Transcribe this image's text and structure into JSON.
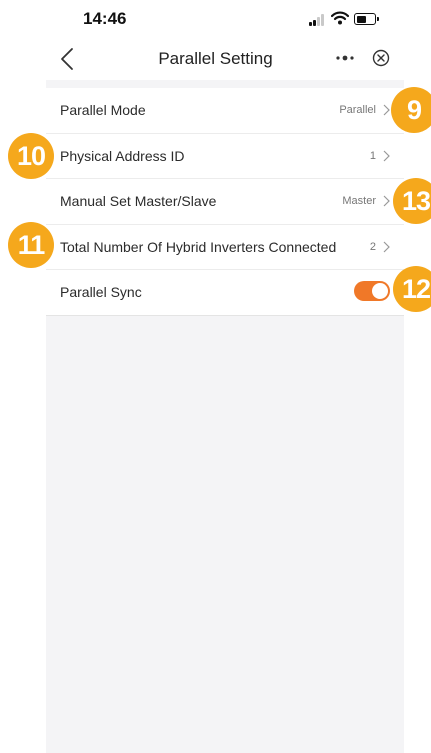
{
  "status_bar": {
    "time": "14:46",
    "icons": [
      "signal-icon",
      "wifi-icon",
      "battery-icon"
    ]
  },
  "nav": {
    "title": "Parallel Setting",
    "back_icon": "chevron-left-icon",
    "more_icon": "more-dots-icon",
    "close_icon": "close-circle-icon"
  },
  "settings": [
    {
      "label": "Parallel Mode",
      "value": "Parallel"
    },
    {
      "label": "Physical Address ID",
      "value": "1"
    },
    {
      "label": "Manual Set Master/Slave",
      "value": "Master"
    },
    {
      "label": "Total Number Of Hybrid Inverters Connected",
      "value": "2"
    },
    {
      "label": "Parallel Sync",
      "toggle_on": true
    }
  ],
  "badges": [
    "9",
    "10",
    "13",
    "11",
    "12"
  ],
  "colors": {
    "accent": "#f07828",
    "badge": "#f5a81c",
    "background": "#f4f4f6"
  }
}
